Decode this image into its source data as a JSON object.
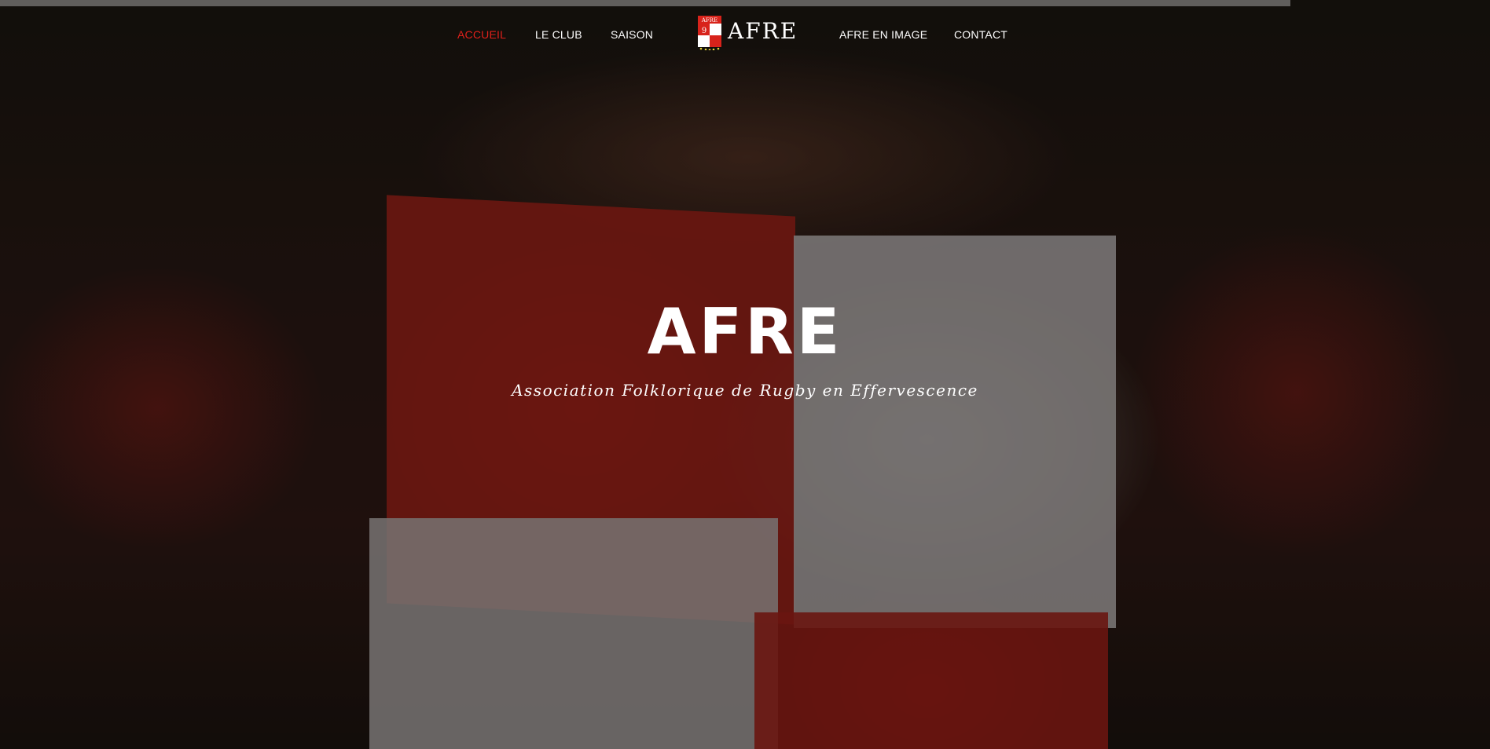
{
  "nav": {
    "items": [
      {
        "label": "ACCUEIL",
        "active": true
      },
      {
        "label": "LE CLUB",
        "active": false
      },
      {
        "label": "SAISON",
        "active": false
      },
      {
        "label": "AFRE EN IMAGE",
        "active": false
      },
      {
        "label": "CONTACT",
        "active": false
      }
    ],
    "logo": {
      "text": "AFRE",
      "badge_text_top": "AFRE",
      "badge_numbers": [
        "9",
        "8"
      ]
    }
  },
  "hero": {
    "title": "AFRE",
    "subtitle": "Association Folklorique de Rugby en Effervescence"
  },
  "colors": {
    "accent": "#e0201a",
    "text": "#ffffff"
  }
}
